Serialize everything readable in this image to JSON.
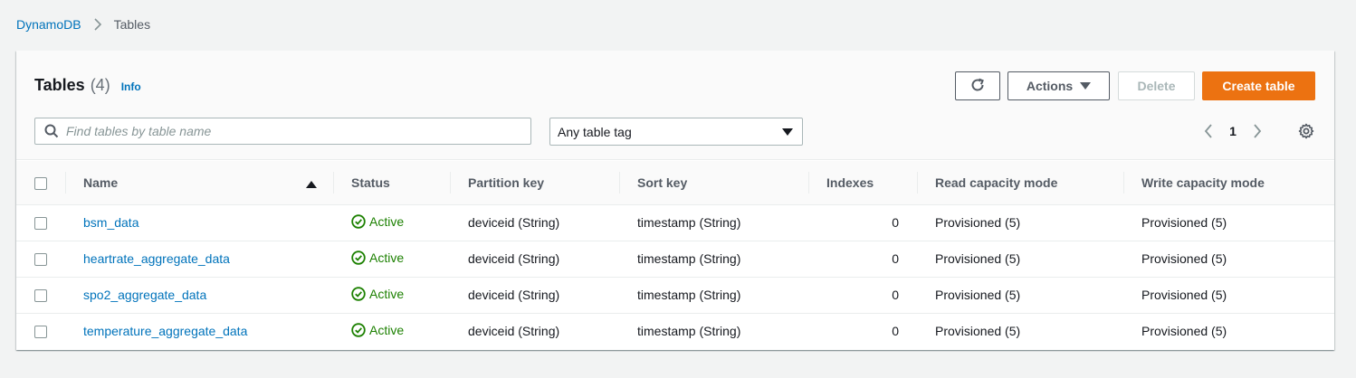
{
  "breadcrumb": {
    "items": [
      {
        "label": "DynamoDB"
      },
      {
        "label": "Tables"
      }
    ]
  },
  "header": {
    "title": "Tables",
    "count": "(4)",
    "info_label": "Info"
  },
  "toolbar": {
    "refresh_icon": "refresh-icon",
    "actions_label": "Actions",
    "delete_label": "Delete",
    "create_label": "Create table"
  },
  "search": {
    "placeholder": "Find tables by table name",
    "value": ""
  },
  "tag_filter": {
    "selected": "Any table tag"
  },
  "pagination": {
    "current_page": "1"
  },
  "colors": {
    "accent": "#ec7211",
    "link": "#0073bb",
    "status_active": "#1d8102"
  },
  "table": {
    "columns": [
      "Name",
      "Status",
      "Partition key",
      "Sort key",
      "Indexes",
      "Read capacity mode",
      "Write capacity mode"
    ],
    "sort": {
      "column": "Name",
      "direction": "ascending"
    },
    "rows": [
      {
        "name": "bsm_data",
        "status": "Active",
        "partition_key": "deviceid (String)",
        "sort_key": "timestamp (String)",
        "indexes": "0",
        "read_capacity": "Provisioned (5)",
        "write_capacity": "Provisioned (5)"
      },
      {
        "name": "heartrate_aggregate_data",
        "status": "Active",
        "partition_key": "deviceid (String)",
        "sort_key": "timestamp (String)",
        "indexes": "0",
        "read_capacity": "Provisioned (5)",
        "write_capacity": "Provisioned (5)"
      },
      {
        "name": "spo2_aggregate_data",
        "status": "Active",
        "partition_key": "deviceid (String)",
        "sort_key": "timestamp (String)",
        "indexes": "0",
        "read_capacity": "Provisioned (5)",
        "write_capacity": "Provisioned (5)"
      },
      {
        "name": "temperature_aggregate_data",
        "status": "Active",
        "partition_key": "deviceid (String)",
        "sort_key": "timestamp (String)",
        "indexes": "0",
        "read_capacity": "Provisioned (5)",
        "write_capacity": "Provisioned (5)"
      }
    ]
  }
}
